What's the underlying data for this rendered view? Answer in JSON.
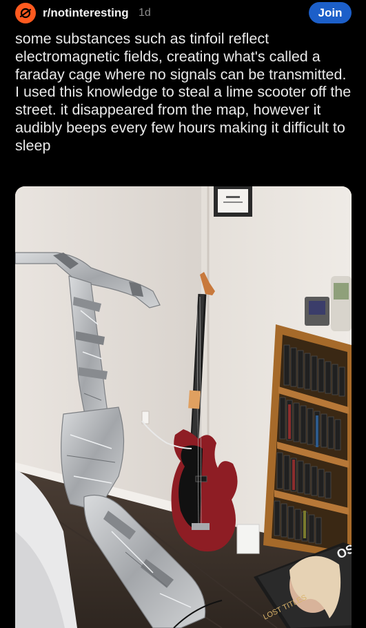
{
  "post": {
    "subreddit": "r/notinteresting",
    "age": "1d",
    "join_label": "Join",
    "text": "some substances such as tinfoil reflect electromagnetic fields, creating what's called a faraday cage where no signals can be transmitted. I used this knowledge to steal a lime scooter off the street. it disappeared from the map, however it audibly beeps every few hours making it difficult to sleep"
  },
  "photo": {
    "book_title": "OSB",
    "book_subtitle": "LOST TITLES"
  },
  "colors": {
    "background": "#000000",
    "join_button": "#1c5fc9",
    "subreddit_avatar": "#ff5a1f",
    "guitar_body": "#8e1d24"
  }
}
